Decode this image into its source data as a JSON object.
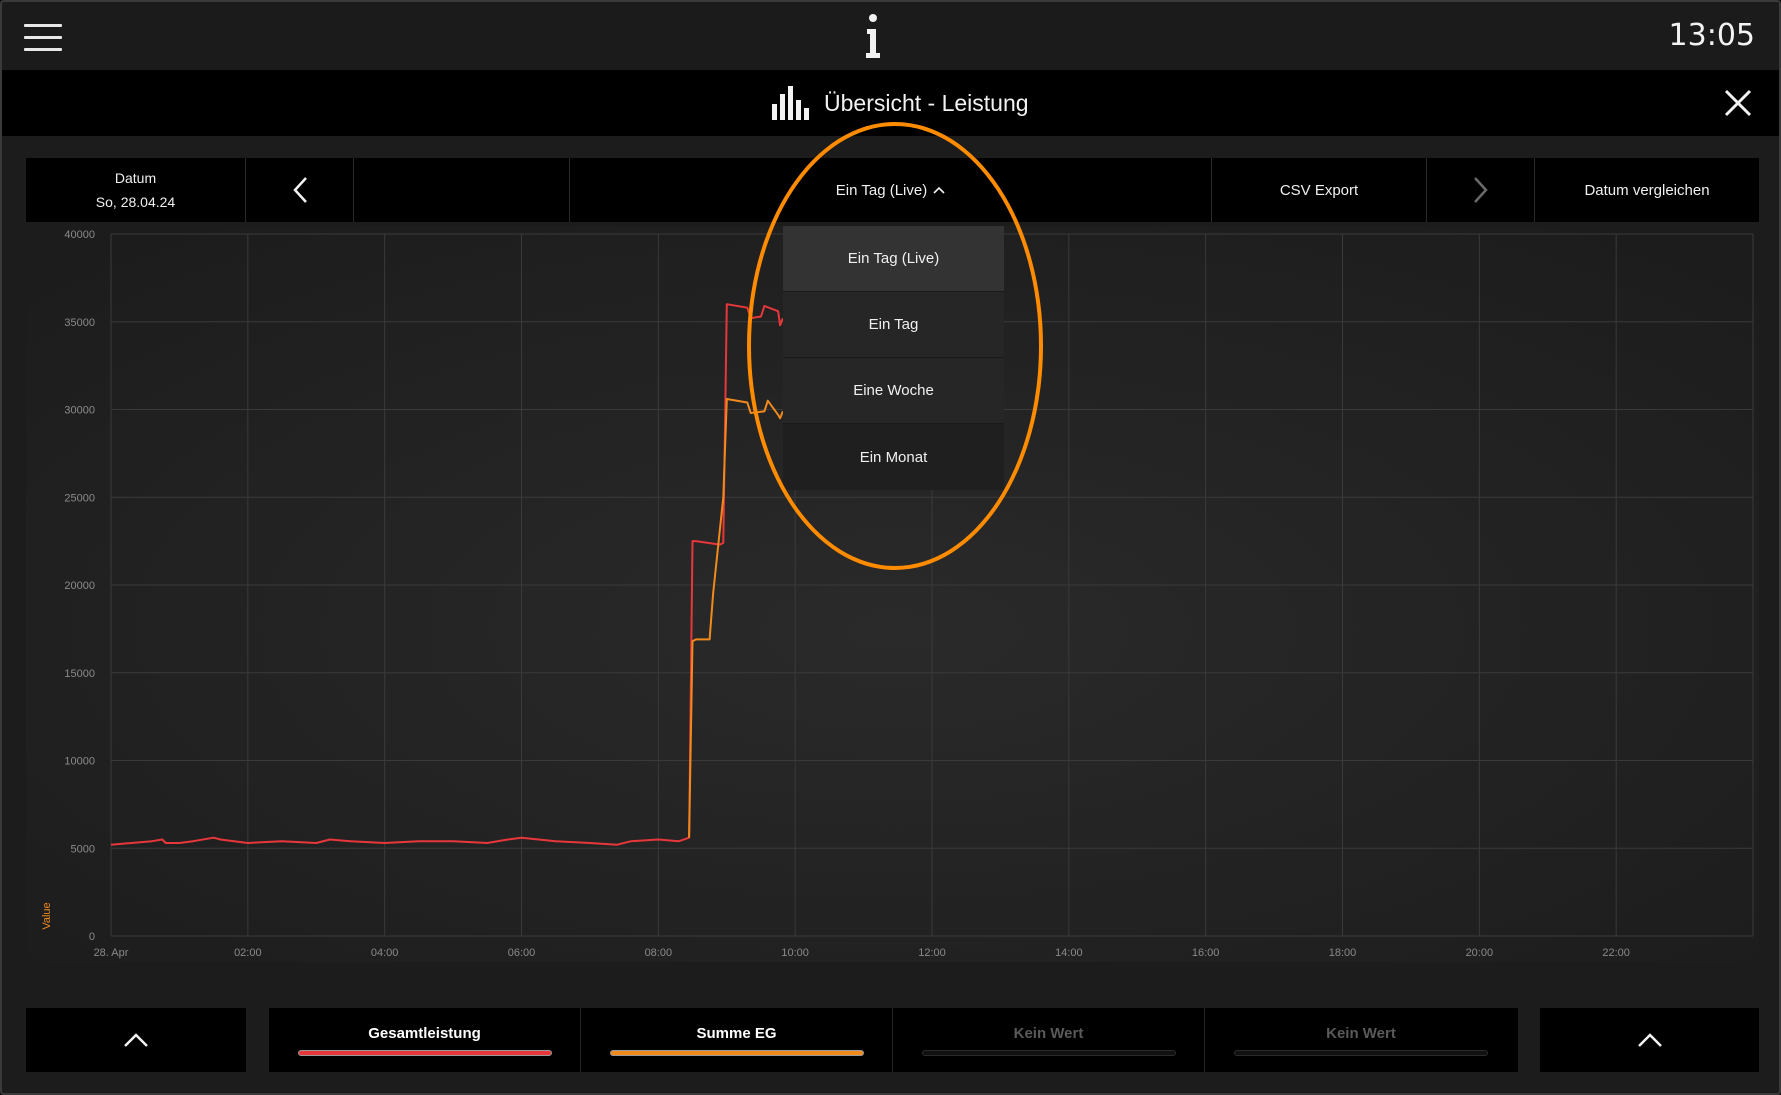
{
  "topbar": {
    "clock": "13:05"
  },
  "header": {
    "title": "Übersicht - Leistung"
  },
  "toolbar": {
    "date_label": "Datum",
    "date_value": "So, 28.04.24",
    "range_label": "Ein Tag (Live)",
    "csv_label": "CSV Export",
    "compare_label": "Datum vergleichen"
  },
  "dropdown": {
    "options": [
      "Ein Tag (Live)",
      "Ein Tag",
      "Eine Woche",
      "Ein Monat"
    ],
    "selected": "Ein Tag (Live)"
  },
  "colors": {
    "series1": "#e8373a",
    "series2": "#f08a1c",
    "highlight": "#ff8c00",
    "grid": "#3a3a3a",
    "axis_text": "#8a8a8a"
  },
  "chart_data": {
    "type": "line",
    "ylabel": "Value",
    "ylim": [
      0,
      40000
    ],
    "xlim_hours": [
      0,
      24
    ],
    "yticks": [
      "0",
      "5000",
      "10000",
      "15000",
      "20000",
      "25000",
      "30000",
      "35000",
      "40000"
    ],
    "xticks": [
      "28. Apr",
      "02:00",
      "04:00",
      "06:00",
      "08:00",
      "10:00",
      "12:00",
      "14:00",
      "16:00",
      "18:00",
      "20:00",
      "22:00"
    ],
    "series": [
      {
        "name": "Gesamtleistung",
        "color": "#e8373a",
        "x": [
          0,
          0.3,
          0.6,
          0.75,
          0.8,
          1.0,
          1.2,
          1.5,
          1.6,
          1.8,
          2.0,
          2.5,
          3.0,
          3.2,
          3.5,
          4.0,
          4.5,
          5.0,
          5.5,
          5.8,
          6.0,
          6.5,
          7.0,
          7.4,
          7.6,
          8.0,
          8.3,
          8.45,
          8.5,
          8.55,
          8.9,
          8.95,
          9.0,
          9.3,
          9.35,
          9.5,
          9.55,
          9.75,
          9.78,
          9.82
        ],
        "y": [
          5200,
          5300,
          5400,
          5500,
          5300,
          5300,
          5400,
          5600,
          5500,
          5400,
          5300,
          5400,
          5300,
          5500,
          5400,
          5300,
          5400,
          5400,
          5300,
          5500,
          5600,
          5400,
          5300,
          5200,
          5400,
          5500,
          5400,
          5600,
          22500,
          22500,
          22300,
          22400,
          36000,
          35800,
          35200,
          35300,
          35900,
          35600,
          34800,
          35200
        ]
      },
      {
        "name": "Summe EG",
        "color": "#f08a1c",
        "x": [
          8.45,
          8.5,
          8.55,
          8.75,
          8.8,
          8.95,
          9.0,
          9.3,
          9.35,
          9.55,
          9.6,
          9.75,
          9.78,
          9.82
        ],
        "y": [
          5600,
          16800,
          16900,
          16900,
          19500,
          25000,
          30600,
          30400,
          29800,
          29900,
          30500,
          29700,
          29500,
          29900
        ]
      }
    ]
  },
  "legend": {
    "items": [
      {
        "label": "Gesamtleistung",
        "color": "#e8373a",
        "active": true
      },
      {
        "label": "Summe EG",
        "color": "#f08a1c",
        "active": true
      },
      {
        "label": "Kein Wert",
        "color": "#5a5a5a",
        "active": false
      },
      {
        "label": "Kein Wert",
        "color": "#5a5a5a",
        "active": false
      }
    ]
  }
}
